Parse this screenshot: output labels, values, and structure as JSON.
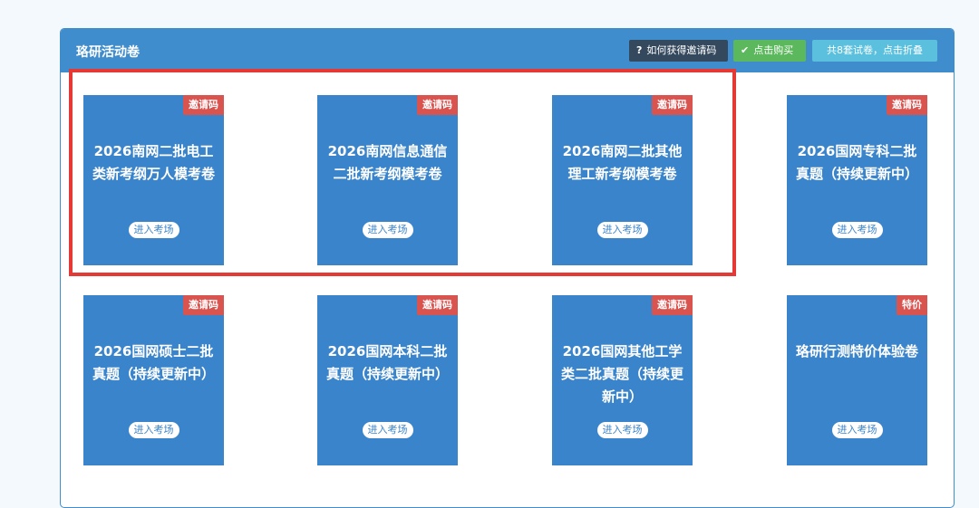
{
  "panel": {
    "title": "珞研活动卷",
    "help_label": "如何获得邀请码",
    "buy_label": "点击购买",
    "fold_label": "共8套试卷，点击折叠"
  },
  "cards": [
    {
      "title": "2026南网二批电工类新考纲万人模考卷",
      "badge": "邀请码",
      "button": "进入考场"
    },
    {
      "title": "2026南网信息通信二批新考纲模考卷",
      "badge": "邀请码",
      "button": "进入考场"
    },
    {
      "title": "2026南网二批其他理工新考纲模考卷",
      "badge": "邀请码",
      "button": "进入考场"
    },
    {
      "title": "2026国网专科二批真题（持续更新中）",
      "badge": "邀请码",
      "button": "进入考场"
    },
    {
      "title": "2026国网硕士二批真题（持续更新中）",
      "badge": "邀请码",
      "button": "进入考场"
    },
    {
      "title": "2026国网本科二批真题（持续更新中）",
      "badge": "邀请码",
      "button": "进入考场"
    },
    {
      "title": "2026国网其他工学类二批真题（持续更新中）",
      "badge": "邀请码",
      "button": "进入考场"
    },
    {
      "title": "珞研行测特价体验卷",
      "badge": "特价",
      "button": "进入考场"
    }
  ],
  "colors": {
    "header": "#3f8dcc",
    "card": "#3a84cc",
    "badge": "#d9534f",
    "buy": "#5cb85c",
    "fold": "#5bc0de",
    "help": "#34495e",
    "highlight": "#e53935"
  },
  "icons": {
    "help": "question-icon",
    "buy": "check-icon"
  }
}
